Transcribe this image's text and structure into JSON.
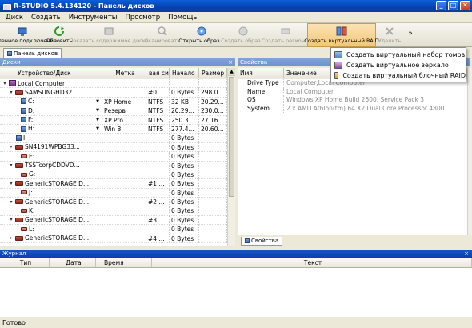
{
  "window": {
    "title": "R-STUDIO 5.4.134120 - Панель дисков"
  },
  "menu": [
    "Диск",
    "Создать",
    "Инструменты",
    "Просмотр",
    "Помощь"
  ],
  "toolbar": [
    {
      "label": "Удаленное подключение",
      "icon": "remote-connect-icon",
      "disabled": false
    },
    {
      "label": "Обновить",
      "icon": "refresh-icon",
      "disabled": false
    },
    {
      "label": "Показать содержимое диска",
      "icon": "show-contents-icon",
      "disabled": true
    },
    {
      "label": "Сканировать",
      "icon": "scan-icon",
      "disabled": true
    },
    {
      "label": "Открыть образ...",
      "icon": "open-image-icon",
      "disabled": false
    },
    {
      "label": "Создать образ...",
      "icon": "create-image-icon",
      "disabled": true
    },
    {
      "label": "Создать регион...",
      "icon": "create-region-icon",
      "disabled": true
    },
    {
      "label": "Создать виртуальный RAID",
      "icon": "virtual-raid-icon",
      "disabled": false
    },
    {
      "label": "Удалить",
      "icon": "delete-icon",
      "disabled": true
    }
  ],
  "toolbar_more": "»",
  "left_tab": "Панель дисков",
  "disks_panel": {
    "title": "Диски",
    "columns": [
      "Устройство/Диск",
      "Метка",
      "вая си",
      "Начало",
      "Размер"
    ],
    "rows": [
      {
        "device": "Local Computer",
        "label": "",
        "fs": "",
        "start": "",
        "size": ""
      },
      {
        "device": "SAMSUNGHD321...",
        "label": "",
        "fs": "#0 ...",
        "start": "0 Bytes",
        "size": "298.0..."
      },
      {
        "device": "C:",
        "label": "XP Home",
        "fs": "NTFS",
        "start": "32 KB",
        "size": "20.29..."
      },
      {
        "device": "D:",
        "label": "Резерв",
        "fs": "NTFS",
        "start": "20.29...",
        "size": "230.0..."
      },
      {
        "device": "F:",
        "label": "XP Pro",
        "fs": "NTFS",
        "start": "250.3...",
        "size": "27.16..."
      },
      {
        "device": "H:",
        "label": "Win 8",
        "fs": "NTFS",
        "start": "277.4...",
        "size": "20.60..."
      },
      {
        "device": "I:",
        "label": "",
        "fs": "",
        "start": "0 Bytes",
        "size": ""
      },
      {
        "device": "SN4191WPBG33...",
        "label": "",
        "fs": "",
        "start": "0 Bytes",
        "size": ""
      },
      {
        "device": "E:",
        "label": "",
        "fs": "",
        "start": "0 Bytes",
        "size": ""
      },
      {
        "device": "TSSTcorpCDDVD...",
        "label": "",
        "fs": "",
        "start": "0 Bytes",
        "size": ""
      },
      {
        "device": "G:",
        "label": "",
        "fs": "",
        "start": "0 Bytes",
        "size": ""
      },
      {
        "device": "GenericSTORAGE D...",
        "label": "",
        "fs": "#1 ...",
        "start": "0 Bytes",
        "size": ""
      },
      {
        "device": "J:",
        "label": "",
        "fs": "",
        "start": "0 Bytes",
        "size": ""
      },
      {
        "device": "GenericSTORAGE D...",
        "label": "",
        "fs": "#2 ...",
        "start": "0 Bytes",
        "size": ""
      },
      {
        "device": "K:",
        "label": "",
        "fs": "",
        "start": "0 Bytes",
        "size": ""
      },
      {
        "device": "GenericSTORAGE D...",
        "label": "",
        "fs": "#3 ...",
        "start": "0 Bytes",
        "size": ""
      },
      {
        "device": "L:",
        "label": "",
        "fs": "",
        "start": "0 Bytes",
        "size": ""
      },
      {
        "device": "GenericSTORAGE D...",
        "label": "",
        "fs": "#4 ...",
        "start": "0 Bytes",
        "size": ""
      }
    ]
  },
  "properties_panel": {
    "title": "Свойства",
    "columns": [
      "Имя",
      "Значение"
    ],
    "rows": [
      {
        "name": "Drive Type",
        "value": "Computer,Local Computer"
      },
      {
        "name": "Name",
        "value": "Local Computer"
      },
      {
        "name": "OS",
        "value": "Windows XP Home Build 2600, Service Pack 3"
      },
      {
        "name": "System",
        "value": "2 x AMD Athlon(tm) 64 X2 Dual Core Processor 4800..."
      }
    ],
    "tab": "Свойства"
  },
  "dropdown": [
    {
      "label": "Создать виртуальный набор томов",
      "icon": "volume-set-icon"
    },
    {
      "label": "Создать виртуальное зеркало",
      "icon": "mirror-icon"
    },
    {
      "label": "Создать виртуальный блочный RAID",
      "icon": "block-raid-icon"
    }
  ],
  "journal": {
    "title": "Журнал",
    "columns": [
      "Тип",
      "Дата",
      "Время",
      "Текст"
    ]
  },
  "status": "Готово",
  "window_buttons": {
    "min": "_",
    "max": "□",
    "close": "✕"
  },
  "panel_close": "×"
}
